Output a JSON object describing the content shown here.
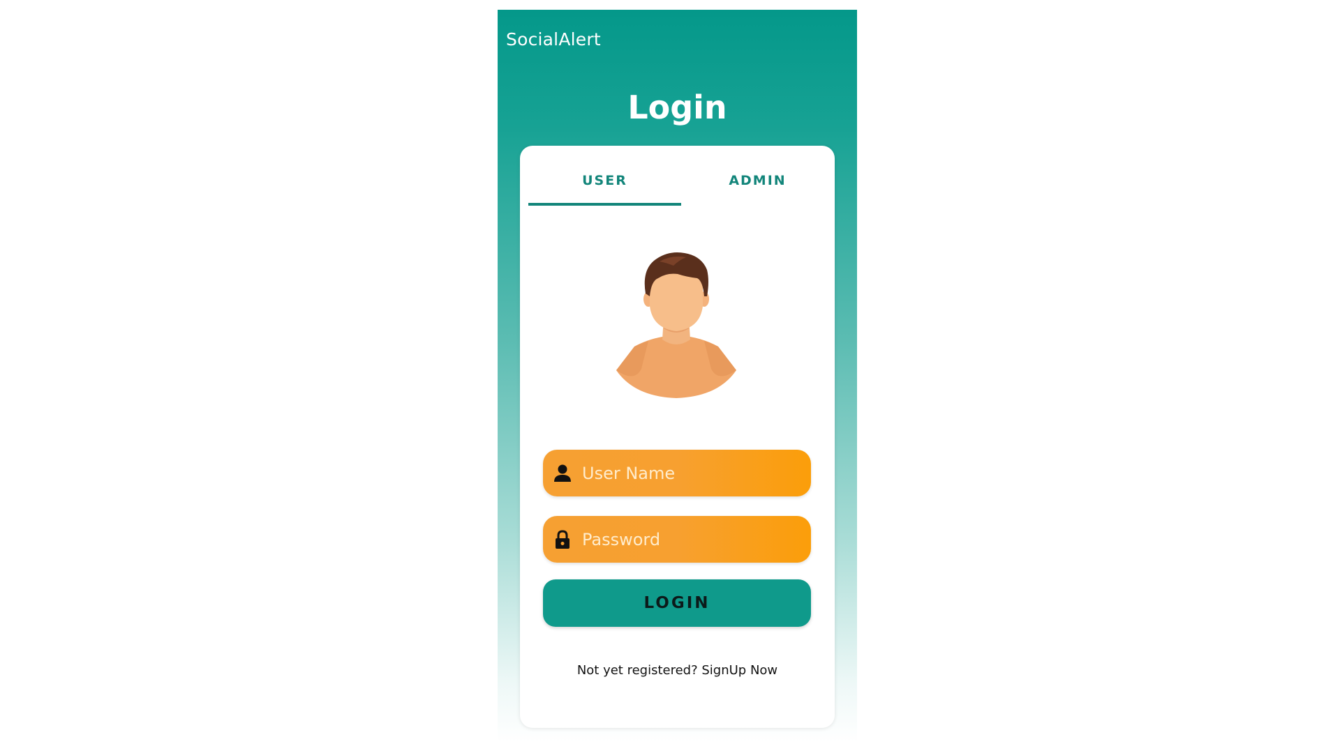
{
  "app": {
    "title": "SocialAlert"
  },
  "page": {
    "title": "Login"
  },
  "tabs": [
    {
      "label": "USER",
      "selected": true
    },
    {
      "label": "ADMIN",
      "selected": false
    }
  ],
  "avatar": {
    "icon": "user-avatar-illustration"
  },
  "form": {
    "username_placeholder": "User Name",
    "username_value": "",
    "username_icon": "person-icon",
    "password_placeholder": "Password",
    "password_value": "",
    "password_icon": "lock-icon",
    "login_label": "LOGIN",
    "signup_prefix": "Not yet registered? ",
    "signup_link": "SignUp Now"
  },
  "colors": {
    "primary": "#0f9a8b",
    "accent": "#f8a023",
    "tab_text": "#12857a"
  }
}
